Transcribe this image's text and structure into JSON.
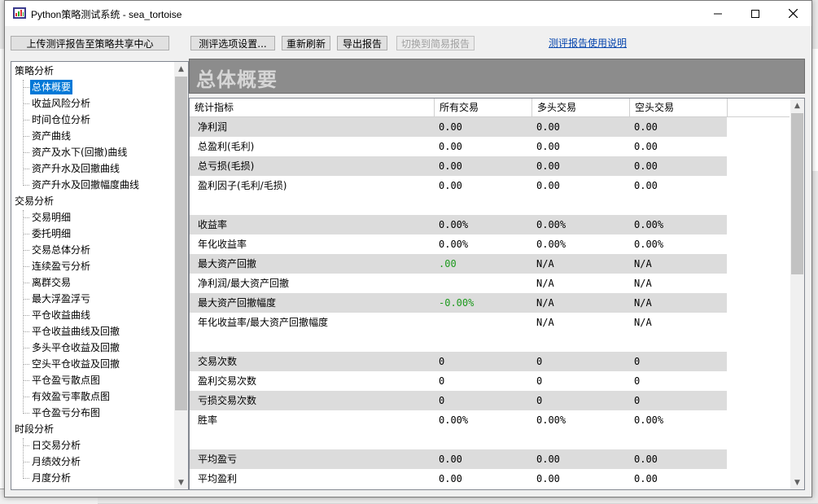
{
  "window": {
    "title": "Python策略测试系统 - sea_tortoise"
  },
  "toolbar": {
    "upload_label": "上传测评报告至策略共享中心",
    "options_label": "测评选项设置...",
    "refresh_label": "重新刷新",
    "export_label": "导出报告",
    "switch_label": "切换到简易报告",
    "help_link": "测评报告使用说明"
  },
  "tree": {
    "groups": [
      {
        "label": "策略分析",
        "items": [
          "总体概要",
          "收益风险分析",
          "时间仓位分析",
          "资产曲线",
          "资产及水下(回撤)曲线",
          "资产升水及回撤曲线",
          "资产升水及回撤幅度曲线"
        ]
      },
      {
        "label": "交易分析",
        "items": [
          "交易明细",
          "委托明细",
          "交易总体分析",
          "连续盈亏分析",
          "离群交易",
          "最大浮盈浮亏",
          "平仓收益曲线",
          "平仓收益曲线及回撤",
          "多头平仓收益及回撤",
          "空头平仓收益及回撤",
          "平仓盈亏散点图",
          "有效盈亏率散点图",
          "平仓盈亏分布图"
        ]
      },
      {
        "label": "时段分析",
        "items": [
          "日交易分析",
          "月绩效分析",
          "月度分析"
        ]
      }
    ],
    "selected": "总体概要"
  },
  "header": {
    "title": "总体概要"
  },
  "table": {
    "columns": [
      "统计指标",
      "所有交易",
      "多头交易",
      "空头交易"
    ],
    "rows": [
      {
        "label": "净利润",
        "all": "0.00",
        "long": "0.00",
        "short": "0.00",
        "shade": true
      },
      {
        "label": "总盈利(毛利)",
        "all": "0.00",
        "long": "0.00",
        "short": "0.00",
        "shade": false
      },
      {
        "label": "总亏损(毛损)",
        "all": "0.00",
        "long": "0.00",
        "short": "0.00",
        "shade": true
      },
      {
        "label": "盈利因子(毛利/毛损)",
        "all": "0.00",
        "long": "0.00",
        "short": "0.00",
        "shade": false
      },
      {
        "label": "",
        "all": "",
        "long": "",
        "short": "",
        "shade": false
      },
      {
        "label": "收益率",
        "all": "0.00%",
        "long": "0.00%",
        "short": "0.00%",
        "shade": true
      },
      {
        "label": "年化收益率",
        "all": "0.00%",
        "long": "0.00%",
        "short": "0.00%",
        "shade": false
      },
      {
        "label": "最大资产回撤",
        "all": ".00",
        "long": "N/A",
        "short": "N/A",
        "shade": true,
        "all_color": "green"
      },
      {
        "label": "净利润/最大资产回撤",
        "all": "",
        "long": "N/A",
        "short": "N/A",
        "shade": false
      },
      {
        "label": "最大资产回撤幅度",
        "all": "-0.00%",
        "long": "N/A",
        "short": "N/A",
        "shade": true,
        "all_color": "green"
      },
      {
        "label": "年化收益率/最大资产回撤幅度",
        "all": "",
        "long": "N/A",
        "short": "N/A",
        "shade": false
      },
      {
        "label": "",
        "all": "",
        "long": "",
        "short": "",
        "shade": false
      },
      {
        "label": "交易次数",
        "all": "0",
        "long": "0",
        "short": "0",
        "shade": true
      },
      {
        "label": "盈利交易次数",
        "all": "0",
        "long": "0",
        "short": "0",
        "shade": false
      },
      {
        "label": "亏损交易次数",
        "all": "0",
        "long": "0",
        "short": "0",
        "shade": true
      },
      {
        "label": "胜率",
        "all": "0.00%",
        "long": "0.00%",
        "short": "0.00%",
        "shade": false
      },
      {
        "label": "",
        "all": "",
        "long": "",
        "short": "",
        "shade": false
      },
      {
        "label": "平均盈亏",
        "all": "0.00",
        "long": "0.00",
        "short": "0.00",
        "shade": true
      },
      {
        "label": "平均盈利",
        "all": "0.00",
        "long": "0.00",
        "short": "0.00",
        "shade": false
      }
    ]
  },
  "colors": {
    "selection": "#0078d7",
    "green": "#1d9a1d",
    "header_band": "#8c8c8c",
    "row_shade": "#dcdcdc"
  },
  "icons": [
    "app-icon",
    "minimize-icon",
    "maximize-icon",
    "close-icon"
  ]
}
